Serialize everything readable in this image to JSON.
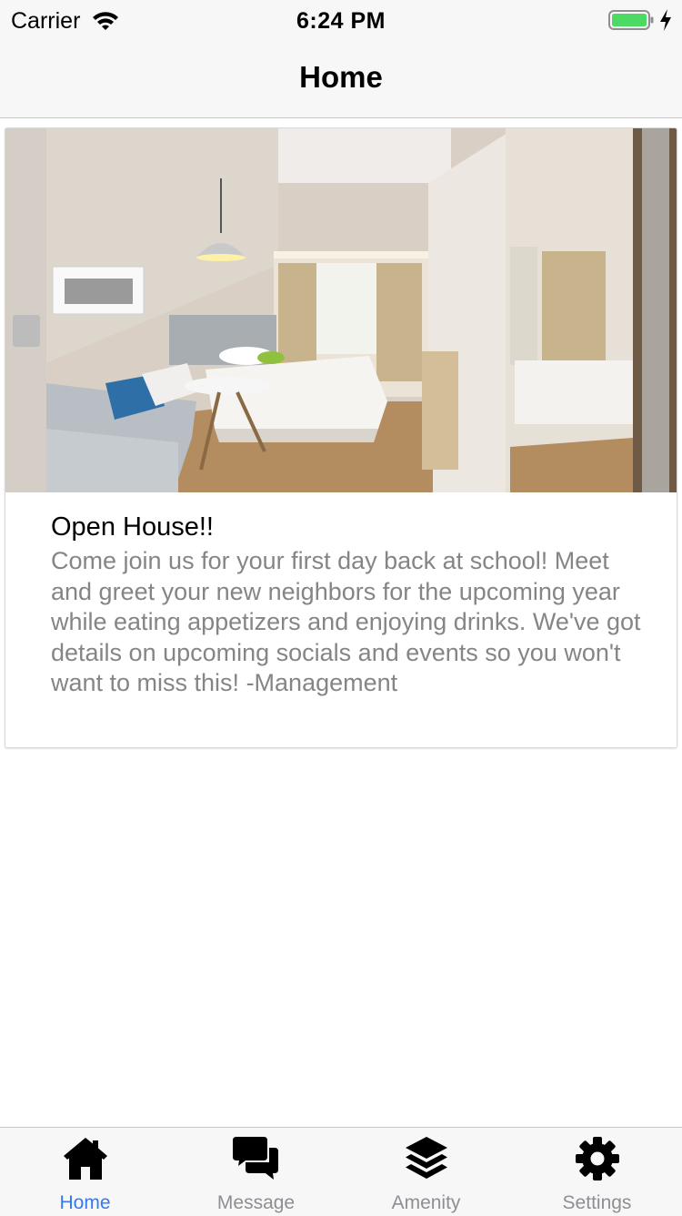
{
  "status_bar": {
    "carrier": "Carrier",
    "time": "6:24 PM",
    "icons": [
      "wifi-icon",
      "battery-icon",
      "charging-bolt-icon"
    ],
    "battery_color": "#4cd964"
  },
  "nav": {
    "title": "Home"
  },
  "card": {
    "image_alt": "hotel-room-photo",
    "title": "Open House!!",
    "body": "Come join us for your first day back at school! Meet and greet your new neighbors for the upcoming year while eating appetizers and enjoying drinks. We've got details on upcoming socials and events so you won't want to miss this! -Management"
  },
  "tabs": [
    {
      "label": "Home",
      "icon": "home-icon",
      "active": true
    },
    {
      "label": "Message",
      "icon": "chat-bubbles-icon",
      "active": false
    },
    {
      "label": "Amenity",
      "icon": "layers-icon",
      "active": false
    },
    {
      "label": "Settings",
      "icon": "gear-icon",
      "active": false
    }
  ],
  "colors": {
    "accent": "#3478f6",
    "inactive_tab": "#8e8e93",
    "body_text": "#858585",
    "bar_background": "#f7f7f7"
  }
}
